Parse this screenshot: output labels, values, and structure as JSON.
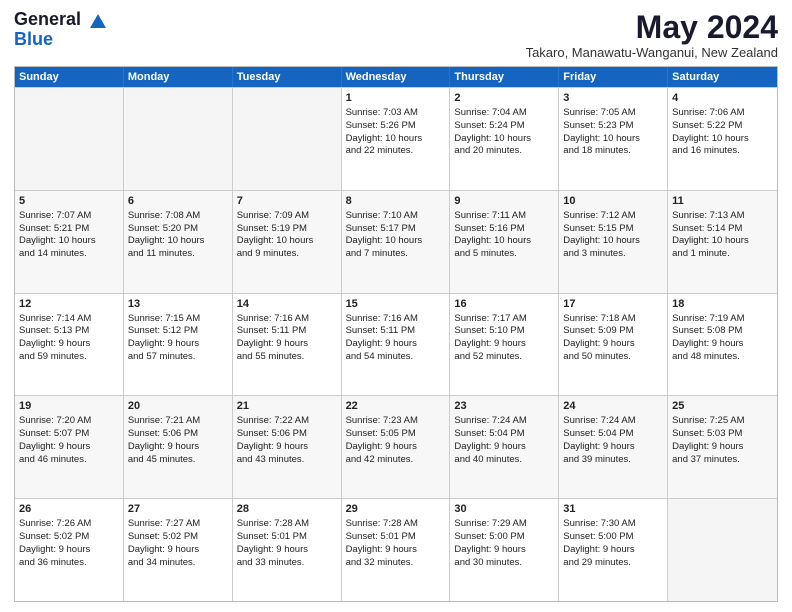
{
  "logo": {
    "general": "General",
    "blue": "Blue"
  },
  "title": "May 2024",
  "subtitle": "Takaro, Manawatu-Wanganui, New Zealand",
  "days": [
    "Sunday",
    "Monday",
    "Tuesday",
    "Wednesday",
    "Thursday",
    "Friday",
    "Saturday"
  ],
  "rows": [
    [
      {
        "day": "",
        "empty": true,
        "lines": []
      },
      {
        "day": "",
        "empty": true,
        "lines": []
      },
      {
        "day": "",
        "empty": true,
        "lines": []
      },
      {
        "day": "1",
        "empty": false,
        "lines": [
          "Sunrise: 7:03 AM",
          "Sunset: 5:26 PM",
          "Daylight: 10 hours",
          "and 22 minutes."
        ]
      },
      {
        "day": "2",
        "empty": false,
        "lines": [
          "Sunrise: 7:04 AM",
          "Sunset: 5:24 PM",
          "Daylight: 10 hours",
          "and 20 minutes."
        ]
      },
      {
        "day": "3",
        "empty": false,
        "lines": [
          "Sunrise: 7:05 AM",
          "Sunset: 5:23 PM",
          "Daylight: 10 hours",
          "and 18 minutes."
        ]
      },
      {
        "day": "4",
        "empty": false,
        "lines": [
          "Sunrise: 7:06 AM",
          "Sunset: 5:22 PM",
          "Daylight: 10 hours",
          "and 16 minutes."
        ]
      }
    ],
    [
      {
        "day": "5",
        "empty": false,
        "lines": [
          "Sunrise: 7:07 AM",
          "Sunset: 5:21 PM",
          "Daylight: 10 hours",
          "and 14 minutes."
        ]
      },
      {
        "day": "6",
        "empty": false,
        "lines": [
          "Sunrise: 7:08 AM",
          "Sunset: 5:20 PM",
          "Daylight: 10 hours",
          "and 11 minutes."
        ]
      },
      {
        "day": "7",
        "empty": false,
        "lines": [
          "Sunrise: 7:09 AM",
          "Sunset: 5:19 PM",
          "Daylight: 10 hours",
          "and 9 minutes."
        ]
      },
      {
        "day": "8",
        "empty": false,
        "lines": [
          "Sunrise: 7:10 AM",
          "Sunset: 5:17 PM",
          "Daylight: 10 hours",
          "and 7 minutes."
        ]
      },
      {
        "day": "9",
        "empty": false,
        "lines": [
          "Sunrise: 7:11 AM",
          "Sunset: 5:16 PM",
          "Daylight: 10 hours",
          "and 5 minutes."
        ]
      },
      {
        "day": "10",
        "empty": false,
        "lines": [
          "Sunrise: 7:12 AM",
          "Sunset: 5:15 PM",
          "Daylight: 10 hours",
          "and 3 minutes."
        ]
      },
      {
        "day": "11",
        "empty": false,
        "lines": [
          "Sunrise: 7:13 AM",
          "Sunset: 5:14 PM",
          "Daylight: 10 hours",
          "and 1 minute."
        ]
      }
    ],
    [
      {
        "day": "12",
        "empty": false,
        "lines": [
          "Sunrise: 7:14 AM",
          "Sunset: 5:13 PM",
          "Daylight: 9 hours",
          "and 59 minutes."
        ]
      },
      {
        "day": "13",
        "empty": false,
        "lines": [
          "Sunrise: 7:15 AM",
          "Sunset: 5:12 PM",
          "Daylight: 9 hours",
          "and 57 minutes."
        ]
      },
      {
        "day": "14",
        "empty": false,
        "lines": [
          "Sunrise: 7:16 AM",
          "Sunset: 5:11 PM",
          "Daylight: 9 hours",
          "and 55 minutes."
        ]
      },
      {
        "day": "15",
        "empty": false,
        "lines": [
          "Sunrise: 7:16 AM",
          "Sunset: 5:11 PM",
          "Daylight: 9 hours",
          "and 54 minutes."
        ]
      },
      {
        "day": "16",
        "empty": false,
        "lines": [
          "Sunrise: 7:17 AM",
          "Sunset: 5:10 PM",
          "Daylight: 9 hours",
          "and 52 minutes."
        ]
      },
      {
        "day": "17",
        "empty": false,
        "lines": [
          "Sunrise: 7:18 AM",
          "Sunset: 5:09 PM",
          "Daylight: 9 hours",
          "and 50 minutes."
        ]
      },
      {
        "day": "18",
        "empty": false,
        "lines": [
          "Sunrise: 7:19 AM",
          "Sunset: 5:08 PM",
          "Daylight: 9 hours",
          "and 48 minutes."
        ]
      }
    ],
    [
      {
        "day": "19",
        "empty": false,
        "lines": [
          "Sunrise: 7:20 AM",
          "Sunset: 5:07 PM",
          "Daylight: 9 hours",
          "and 46 minutes."
        ]
      },
      {
        "day": "20",
        "empty": false,
        "lines": [
          "Sunrise: 7:21 AM",
          "Sunset: 5:06 PM",
          "Daylight: 9 hours",
          "and 45 minutes."
        ]
      },
      {
        "day": "21",
        "empty": false,
        "lines": [
          "Sunrise: 7:22 AM",
          "Sunset: 5:06 PM",
          "Daylight: 9 hours",
          "and 43 minutes."
        ]
      },
      {
        "day": "22",
        "empty": false,
        "lines": [
          "Sunrise: 7:23 AM",
          "Sunset: 5:05 PM",
          "Daylight: 9 hours",
          "and 42 minutes."
        ]
      },
      {
        "day": "23",
        "empty": false,
        "lines": [
          "Sunrise: 7:24 AM",
          "Sunset: 5:04 PM",
          "Daylight: 9 hours",
          "and 40 minutes."
        ]
      },
      {
        "day": "24",
        "empty": false,
        "lines": [
          "Sunrise: 7:24 AM",
          "Sunset: 5:04 PM",
          "Daylight: 9 hours",
          "and 39 minutes."
        ]
      },
      {
        "day": "25",
        "empty": false,
        "lines": [
          "Sunrise: 7:25 AM",
          "Sunset: 5:03 PM",
          "Daylight: 9 hours",
          "and 37 minutes."
        ]
      }
    ],
    [
      {
        "day": "26",
        "empty": false,
        "lines": [
          "Sunrise: 7:26 AM",
          "Sunset: 5:02 PM",
          "Daylight: 9 hours",
          "and 36 minutes."
        ]
      },
      {
        "day": "27",
        "empty": false,
        "lines": [
          "Sunrise: 7:27 AM",
          "Sunset: 5:02 PM",
          "Daylight: 9 hours",
          "and 34 minutes."
        ]
      },
      {
        "day": "28",
        "empty": false,
        "lines": [
          "Sunrise: 7:28 AM",
          "Sunset: 5:01 PM",
          "Daylight: 9 hours",
          "and 33 minutes."
        ]
      },
      {
        "day": "29",
        "empty": false,
        "lines": [
          "Sunrise: 7:28 AM",
          "Sunset: 5:01 PM",
          "Daylight: 9 hours",
          "and 32 minutes."
        ]
      },
      {
        "day": "30",
        "empty": false,
        "lines": [
          "Sunrise: 7:29 AM",
          "Sunset: 5:00 PM",
          "Daylight: 9 hours",
          "and 30 minutes."
        ]
      },
      {
        "day": "31",
        "empty": false,
        "lines": [
          "Sunrise: 7:30 AM",
          "Sunset: 5:00 PM",
          "Daylight: 9 hours",
          "and 29 minutes."
        ]
      },
      {
        "day": "",
        "empty": true,
        "lines": []
      }
    ]
  ]
}
